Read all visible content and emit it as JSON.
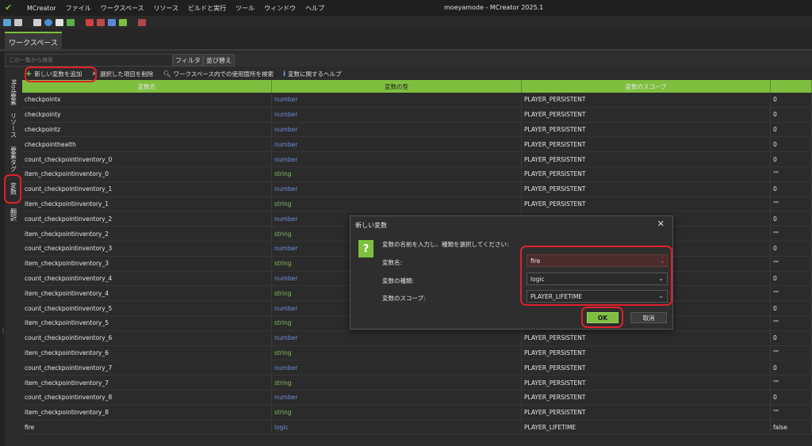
{
  "app": {
    "name": "MCreator",
    "window_title": "moeyamode - MCreator 2025.1",
    "menu": [
      "ファイル",
      "ワークスペース",
      "リソース",
      "ビルドと実行",
      "ツール",
      "ウィンドウ",
      "ヘルプ"
    ]
  },
  "workspace_tab": "ワークスペース",
  "search": {
    "placeholder": "この一覧から検索",
    "filter_label": "フィルタ",
    "sort_label": "並び替え"
  },
  "side_tabs": [
    "Mod要素",
    "リソース",
    "要素タグ",
    "変数",
    "翻訳"
  ],
  "actions": {
    "add": "新しい変数を追加",
    "delete": "選択した項目を削除",
    "find_usages": "ワークスペース内での使用箇所を検索",
    "help": "変数に関するヘルプ"
  },
  "table": {
    "headers": [
      "変数名",
      "変数の型",
      "変数のスコープ",
      ""
    ],
    "rows": [
      [
        "checkpointx",
        "number",
        "PLAYER_PERSISTENT",
        "0"
      ],
      [
        "checkpointy",
        "number",
        "PLAYER_PERSISTENT",
        "0"
      ],
      [
        "checkpointz",
        "number",
        "PLAYER_PERSISTENT",
        "0"
      ],
      [
        "checkpointhealth",
        "number",
        "PLAYER_PERSISTENT",
        "0"
      ],
      [
        "count_checkpointinventory_0",
        "number",
        "PLAYER_PERSISTENT",
        "0"
      ],
      [
        "item_checkpointinventory_0",
        "string",
        "PLAYER_PERSISTENT",
        "\"\""
      ],
      [
        "count_checkpointinventory_1",
        "number",
        "PLAYER_PERSISTENT",
        "0"
      ],
      [
        "item_checkpointinventory_1",
        "string",
        "PLAYER_PERSISTENT",
        "\"\""
      ],
      [
        "count_checkpointinventory_2",
        "number",
        "",
        "0"
      ],
      [
        "item_checkpointinventory_2",
        "string",
        "",
        "\"\""
      ],
      [
        "count_checkpointinventory_3",
        "number",
        "",
        "0"
      ],
      [
        "item_checkpointinventory_3",
        "string",
        "",
        "\"\""
      ],
      [
        "count_checkpointinventory_4",
        "number",
        "",
        "0"
      ],
      [
        "item_checkpointinventory_4",
        "string",
        "",
        "\"\""
      ],
      [
        "count_checkpointinventory_5",
        "number",
        "",
        "0"
      ],
      [
        "item_checkpointinventory_5",
        "string",
        "",
        "\"\""
      ],
      [
        "count_checkpointinventory_6",
        "number",
        "PLAYER_PERSISTENT",
        "0"
      ],
      [
        "item_checkpointinventory_6",
        "string",
        "PLAYER_PERSISTENT",
        "\"\""
      ],
      [
        "count_checkpointinventory_7",
        "number",
        "PLAYER_PERSISTENT",
        "0"
      ],
      [
        "item_checkpointinventory_7",
        "string",
        "PLAYER_PERSISTENT",
        "\"\""
      ],
      [
        "count_checkpointinventory_8",
        "number",
        "PLAYER_PERSISTENT",
        "0"
      ],
      [
        "item_checkpointinventory_8",
        "string",
        "PLAYER_PERSISTENT",
        "\"\""
      ],
      [
        "fire",
        "logic",
        "PLAYER_LIFETIME",
        "false"
      ]
    ]
  },
  "dialog": {
    "title": "新しい変数",
    "close_glyph": "✕",
    "icon_glyph": "?",
    "prompt": "変数の名前を入力し、種類を選択してください:",
    "name_label": "変数名:",
    "name_value": "fire",
    "type_label": "変数の種類:",
    "type_value": "logic",
    "scope_label": "変数のスコープ:",
    "scope_value": "PLAYER_LIFETIME",
    "ok_label": "OK",
    "cancel_label": "取消"
  },
  "colors": {
    "accent": "#7fbf3f",
    "type_number": "#6e8fdd",
    "type_string": "#7cc060",
    "annotation": "#e0202a"
  }
}
